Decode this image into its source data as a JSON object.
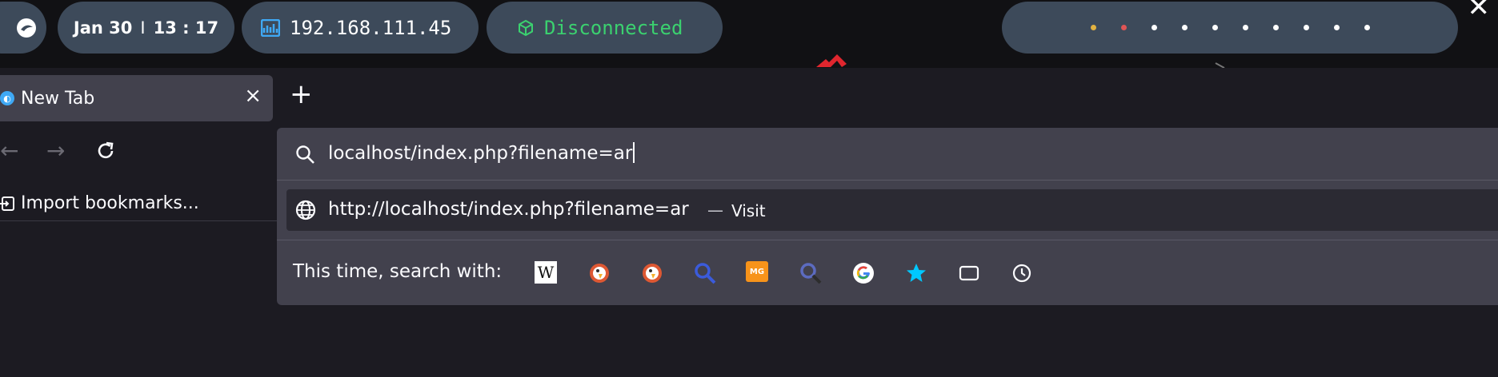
{
  "topbar": {
    "date": "Jan 30",
    "separator": "I",
    "time": "13 : 17",
    "ip": "192.168.111.45",
    "network_status": "Disconnected",
    "workspace_dots": [
      "#e3b341",
      "#e05555",
      "#ffffff",
      "#ffffff",
      "#ffffff",
      "#ffffff",
      "#ffffff",
      "#ffffff",
      "#ffffff",
      "#ffffff"
    ],
    "close": "✕"
  },
  "tabs": [
    {
      "title": "New Tab",
      "close": "×"
    }
  ],
  "new_tab_label": "+",
  "nav": {
    "back": "←",
    "forward": "→",
    "reload": "↻"
  },
  "bookmarks": {
    "import_label": "Import bookmarks..."
  },
  "urlbar": {
    "value": "localhost/index.php?filename=ar",
    "suggestion": {
      "url": "http://localhost/index.php?filename=ar",
      "separator": "—",
      "action": "Visit"
    },
    "search_with_label": "This time, search with:",
    "engines": [
      "wikipedia-icon",
      "duckduckgo-icon",
      "duckduckgo-icon",
      "search-engine-icon",
      "mg-icon",
      "search-engine-icon",
      "google-icon",
      "bookmarks-star-icon",
      "tabs-icon",
      "history-icon"
    ]
  },
  "colors": {
    "accent_green": "#3bd16f",
    "panel": "#42414d",
    "background": "#1c1b22"
  }
}
